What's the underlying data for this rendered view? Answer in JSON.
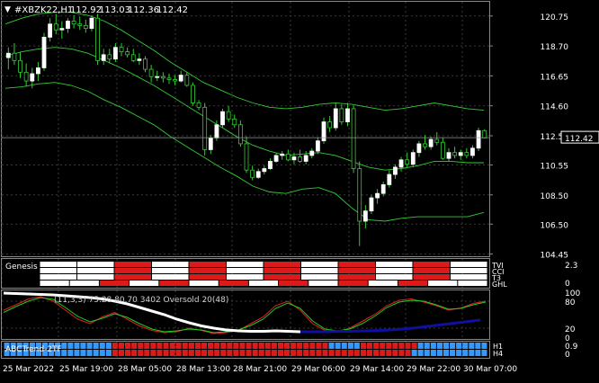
{
  "header": {
    "symbol": "#XBZK22,H1",
    "o": "112.92",
    "h": "113.03",
    "l": "112.36",
    "c": "112.42"
  },
  "colors": {
    "up": "#ffffff",
    "down": "#33cc33",
    "band": "#33cc33",
    "grid": "#3a3a3a",
    "red": "#dd1a1a",
    "white": "#ffffff",
    "blue": "#3399ff",
    "navy": "#1010a0"
  },
  "chart_data": [
    {
      "type": "candlestick",
      "title": "#XBZK22,H1",
      "ylim": [
        104.3,
        121.6
      ],
      "yticks": [
        120.75,
        118.7,
        116.65,
        114.6,
        112.55,
        110.55,
        108.5,
        106.5,
        104.45
      ],
      "current_price": 112.42,
      "x": [
        "25 Mar 2022",
        "25 Mar 19:00",
        "28 Mar 05:00",
        "28 Mar 13:00",
        "28 Mar 21:00",
        "29 Mar 06:00",
        "29 Mar 14:00",
        "29 Mar 22:00",
        "30 Mar 07:00"
      ],
      "candles": [
        [
          117.9,
          118.6,
          117.1,
          118.2
        ],
        [
          118.2,
          118.9,
          117.4,
          117.7
        ],
        [
          117.7,
          118.3,
          116.5,
          116.9
        ],
        [
          116.9,
          117.5,
          115.9,
          116.3
        ],
        [
          116.3,
          117.2,
          115.8,
          116.8
        ],
        [
          116.8,
          117.6,
          116.3,
          117.2
        ],
        [
          117.2,
          119.6,
          117.0,
          119.3
        ],
        [
          119.3,
          120.6,
          119.0,
          120.2
        ],
        [
          120.2,
          120.9,
          119.5,
          119.8
        ],
        [
          119.8,
          120.4,
          119.2,
          119.9
        ],
        [
          119.9,
          120.6,
          119.6,
          120.4
        ],
        [
          120.4,
          120.8,
          119.9,
          120.2
        ],
        [
          120.2,
          120.7,
          119.8,
          120.1
        ],
        [
          120.1,
          120.5,
          119.6,
          119.9
        ],
        [
          119.9,
          120.8,
          119.7,
          120.6
        ],
        [
          120.6,
          120.9,
          117.4,
          117.7
        ],
        [
          117.7,
          118.5,
          117.4,
          118.1
        ],
        [
          118.1,
          118.5,
          117.5,
          117.8
        ],
        [
          117.8,
          118.9,
          117.6,
          118.6
        ],
        [
          118.6,
          118.9,
          118.0,
          118.3
        ],
        [
          118.3,
          118.6,
          117.9,
          118.1
        ],
        [
          118.1,
          118.5,
          117.6,
          117.7
        ],
        [
          117.7,
          118.2,
          117.4,
          117.8
        ],
        [
          117.8,
          118.0,
          116.9,
          117.1
        ],
        [
          117.1,
          117.4,
          116.2,
          116.6
        ],
        [
          116.6,
          117.0,
          116.3,
          116.6
        ],
        [
          116.6,
          116.9,
          116.2,
          116.5
        ],
        [
          116.5,
          116.8,
          116.1,
          116.4
        ],
        [
          116.4,
          116.7,
          116.0,
          116.3
        ],
        [
          116.3,
          117.0,
          116.2,
          116.7
        ],
        [
          116.7,
          116.9,
          115.9,
          116.0
        ],
        [
          116.0,
          116.2,
          114.6,
          114.8
        ],
        [
          114.8,
          115.0,
          114.3,
          114.5
        ],
        [
          114.5,
          114.8,
          111.2,
          111.6
        ],
        [
          111.6,
          112.6,
          111.3,
          112.4
        ],
        [
          112.4,
          113.6,
          112.2,
          113.3
        ],
        [
          113.3,
          114.4,
          113.1,
          114.2
        ],
        [
          114.2,
          114.6,
          113.5,
          113.7
        ],
        [
          113.7,
          114.0,
          113.1,
          113.3
        ],
        [
          113.3,
          113.6,
          111.8,
          112.0
        ],
        [
          112.0,
          112.5,
          110.0,
          110.2
        ],
        [
          110.2,
          110.5,
          109.5,
          109.7
        ],
        [
          109.7,
          110.3,
          109.6,
          110.1
        ],
        [
          110.1,
          110.5,
          109.9,
          110.3
        ],
        [
          110.3,
          111.0,
          110.2,
          110.8
        ],
        [
          110.8,
          111.4,
          110.7,
          111.2
        ],
        [
          111.2,
          111.5,
          110.9,
          111.3
        ],
        [
          111.3,
          111.6,
          110.8,
          110.9
        ],
        [
          110.9,
          111.4,
          110.6,
          111.1
        ],
        [
          111.1,
          111.6,
          110.7,
          110.8
        ],
        [
          110.8,
          111.5,
          110.6,
          111.2
        ],
        [
          111.2,
          111.7,
          111.0,
          111.5
        ],
        [
          111.5,
          112.4,
          111.3,
          112.2
        ],
        [
          112.2,
          113.8,
          112.0,
          113.5
        ],
        [
          113.5,
          113.9,
          112.8,
          113.1
        ],
        [
          113.1,
          114.8,
          112.9,
          114.4
        ],
        [
          114.4,
          114.7,
          113.3,
          113.5
        ],
        [
          113.5,
          114.8,
          113.2,
          114.4
        ],
        [
          114.4,
          114.6,
          110.0,
          110.3
        ],
        [
          110.3,
          110.8,
          105.0,
          106.7
        ],
        [
          106.7,
          107.8,
          106.2,
          107.4
        ],
        [
          107.4,
          108.5,
          107.2,
          108.3
        ],
        [
          108.3,
          108.9,
          107.9,
          108.6
        ],
        [
          108.6,
          109.4,
          108.4,
          109.2
        ],
        [
          109.2,
          110.2,
          109.0,
          109.9
        ],
        [
          109.9,
          110.6,
          109.6,
          110.4
        ],
        [
          110.4,
          111.1,
          110.1,
          110.9
        ],
        [
          110.9,
          111.4,
          110.4,
          110.6
        ],
        [
          110.6,
          111.6,
          110.4,
          111.4
        ],
        [
          111.4,
          112.2,
          111.1,
          112.0
        ],
        [
          112.0,
          112.6,
          111.6,
          111.8
        ],
        [
          111.8,
          112.5,
          111.6,
          112.3
        ],
        [
          112.3,
          112.8,
          111.9,
          112.1
        ],
        [
          112.1,
          112.4,
          110.9,
          111.0
        ],
        [
          111.0,
          111.7,
          110.8,
          111.4
        ],
        [
          111.4,
          111.8,
          111.0,
          111.2
        ],
        [
          111.2,
          111.6,
          110.9,
          111.4
        ],
        [
          111.4,
          111.7,
          111.0,
          111.2
        ],
        [
          111.2,
          111.9,
          111.0,
          111.7
        ],
        [
          111.7,
          113.1,
          111.5,
          112.9
        ],
        [
          112.9,
          113.0,
          112.4,
          112.4
        ]
      ],
      "envelope": {
        "upper": [
          120.2,
          120.6,
          120.9,
          121.0,
          121.0,
          120.8,
          120.4,
          119.8,
          119.1,
          118.4,
          117.6,
          116.9,
          116.2,
          115.7,
          115.2,
          114.8,
          114.5,
          114.4,
          114.5,
          114.7,
          114.8,
          114.7,
          114.5,
          114.3,
          114.4,
          114.6,
          114.8,
          114.6,
          114.4,
          114.3
        ],
        "middle": [
          118.0,
          118.3,
          118.5,
          118.6,
          118.5,
          118.2,
          117.7,
          117.2,
          116.6,
          116.0,
          115.3,
          114.6,
          113.9,
          113.2,
          112.5,
          111.9,
          111.5,
          111.2,
          111.3,
          111.4,
          111.2,
          110.8,
          110.4,
          110.2,
          110.3,
          110.5,
          110.8,
          110.8,
          110.7,
          110.7
        ],
        "lower": [
          115.8,
          115.9,
          116.1,
          116.2,
          116.0,
          115.6,
          115.0,
          114.5,
          113.9,
          113.3,
          112.5,
          111.8,
          111.1,
          110.4,
          109.8,
          109.1,
          108.7,
          108.6,
          108.9,
          109.0,
          108.6,
          107.6,
          106.8,
          106.7,
          106.9,
          107.0,
          107.0,
          107.0,
          107.0,
          107.3
        ]
      }
    },
    {
      "type": "heatmap",
      "title": "Genesis",
      "ylim": [
        0,
        2.3
      ],
      "yticks": [
        "2.3",
        "0"
      ],
      "rows": [
        "TVI",
        "CCI",
        "T3",
        "GHL"
      ],
      "cells": [
        "ww>(9)r>(1)w>(16)r>(2)w>(7)r>(4)w>(11)r>(4)w>(17)r>(1)w",
        "ww>(9)r>(1)w>(16)r>(3)w>(6)r>(4)w>(10)r>(6)w>(15)r>(1)w",
        "ww>(9)r>(1)w>(22)r>(6)w>(14)r>(2)w>(4)r>(4)w>(1)r>(1)w",
        "ww>(9)r>(1)w>(16)r>(3)w>(6)r>(6)w>(2)r>(2)w>(10)r>(1)w>(11)r>(1)w>(1)w"
      ]
    },
    {
      "type": "line",
      "title": "",
      "legend_text": "(11,3,3) 75.28 80.70 3402 Oversold 20(48)",
      "ylim": [
        0,
        100
      ],
      "yticks": [
        "100",
        "80",
        "20",
        "0"
      ],
      "series": []
    },
    {
      "type": "heatmap",
      "title": "ABCTrend",
      "legend_text": "ABCTrend-2TF",
      "ylim": [
        0,
        0.9
      ],
      "yticks": [
        "0.9",
        "0"
      ],
      "rows": [
        "H1",
        "H4"
      ],
      "cells": [
        "bbbbbbbbbbbbbbbbbrrrrrrrrrrrrrrrrrrrrrrrrrrrrrrrrrrbbbbbrrrrrrrrrbbbbbbbbbbb",
        "bbbbbbbbbbbbbbbbbrrrrrrrrrrrrrrrrrrrrrrrrrrrrrrrrrrrrrrrrrrrrrrrbbbbbbbbbbbb"
      ]
    }
  ]
}
